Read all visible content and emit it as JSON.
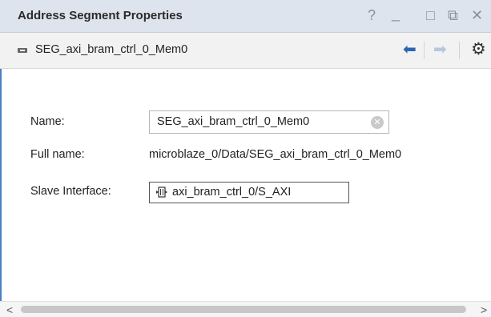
{
  "window": {
    "title": "Address Segment Properties",
    "controls": [
      {
        "name": "help",
        "glyph": "?"
      },
      {
        "name": "minimize",
        "glyph": "_"
      },
      {
        "name": "maximize",
        "glyph": "□"
      },
      {
        "name": "float",
        "glyph": "⧉"
      },
      {
        "name": "close",
        "glyph": "✕"
      }
    ]
  },
  "toolbar": {
    "object_label": "SEG_axi_bram_ctrl_0_Mem0",
    "back_glyph": "⬅",
    "forward_glyph": "➡",
    "settings_glyph": "⚙"
  },
  "form": {
    "name_label": "Name:",
    "name_value": "SEG_axi_bram_ctrl_0_Mem0",
    "clear_glyph": "✕",
    "fullname_label": "Full name:",
    "fullname_value": "microblaze_0/Data/SEG_axi_bram_ctrl_0_Mem0",
    "slave_label": "Slave Interface:",
    "slave_value": "axi_bram_ctrl_0/S_AXI"
  },
  "scrollbar": {
    "left_glyph": "<",
    "right_glyph": ">"
  },
  "colors": {
    "titlebar_bg": "#dde4ee",
    "accent": "#2d64b3",
    "toolbar_bg": "#f2f2f2"
  }
}
